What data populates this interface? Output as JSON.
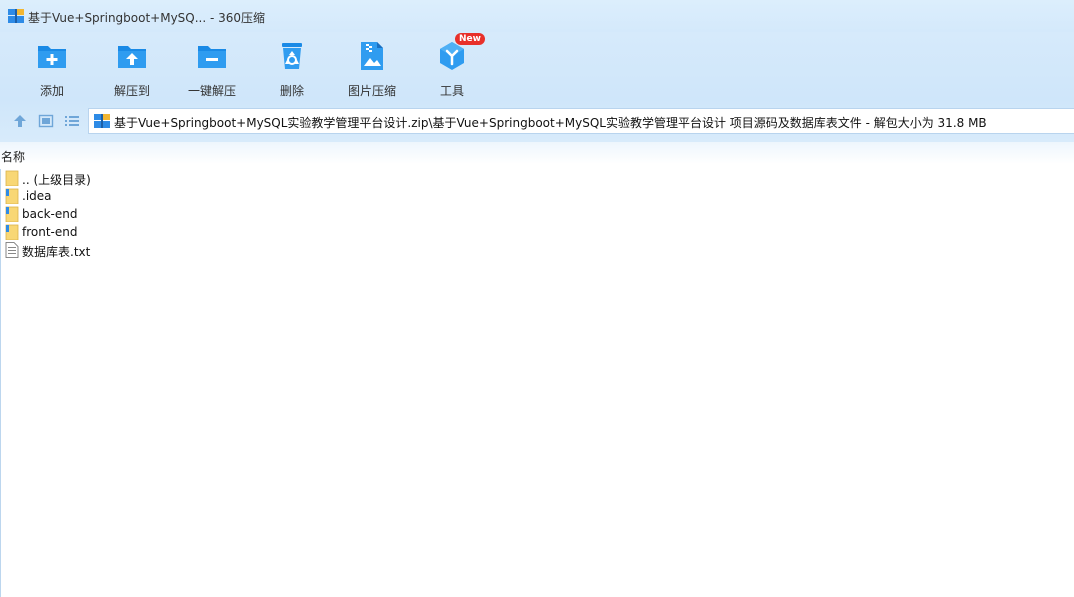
{
  "window": {
    "title": "基于Vue+Springboot+MySQ... - 360压缩"
  },
  "toolbar": {
    "items": [
      {
        "label": "添加",
        "icon": "add-folder-icon"
      },
      {
        "label": "解压到",
        "icon": "extract-to-icon"
      },
      {
        "label": "一键解压",
        "icon": "one-click-extract-icon"
      },
      {
        "label": "删除",
        "icon": "recycle-bin-icon"
      },
      {
        "label": "图片压缩",
        "icon": "image-compress-icon"
      },
      {
        "label": "工具",
        "icon": "tools-icon"
      }
    ],
    "new_badge": "New"
  },
  "navigation": {
    "buttons": [
      "up-arrow-icon",
      "view-thumbnail-icon",
      "view-list-icon"
    ],
    "address": "基于Vue+Springboot+MySQL实验教学管理平台设计.zip\\基于Vue+Springboot+MySQL实验教学管理平台设计 项目源码及数据库表文件 - 解包大小为 31.8 MB"
  },
  "list": {
    "column_name": "名称",
    "files": [
      {
        "name": ".. (上级目录)",
        "type": "folder-up"
      },
      {
        "name": ".idea",
        "type": "folder"
      },
      {
        "name": "back-end",
        "type": "folder"
      },
      {
        "name": "front-end",
        "type": "folder"
      },
      {
        "name": "数据库表.txt",
        "type": "text-file"
      }
    ]
  },
  "colors": {
    "accent": "#1a8ae6",
    "toolbar_bg": "#d2e8fb",
    "badge": "#e8302a"
  }
}
